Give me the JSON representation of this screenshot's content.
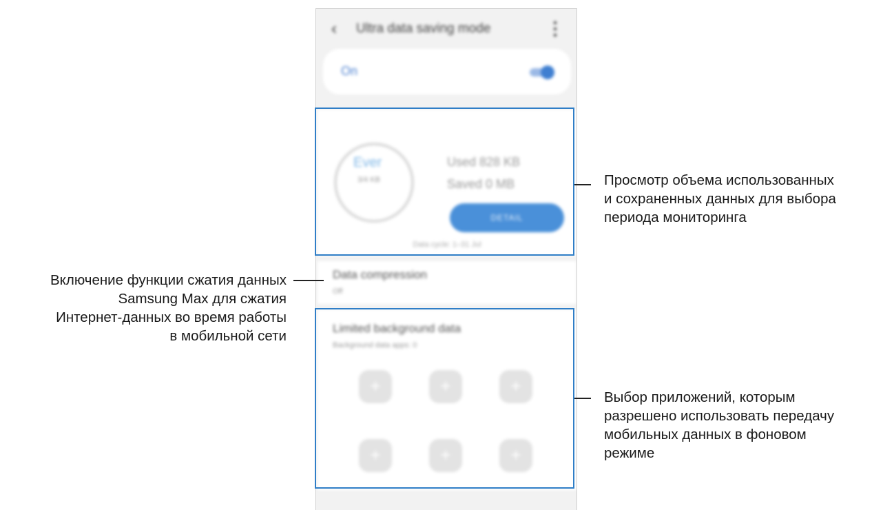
{
  "phone": {
    "appbar": {
      "title": "Ultra data saving mode"
    },
    "toggle": {
      "label": "On",
      "state": "on"
    },
    "usage": {
      "ring_value": "Ever",
      "ring_sub": "3/4 KB",
      "used": "Used 828 KB",
      "saved": "Saved 0 MB",
      "detail_button": "DETAIL",
      "cycle": "Data cycle: 1–31 Jul"
    },
    "compression": {
      "title": "Data compression",
      "subtitle": "Off"
    },
    "background": {
      "title": "Limited background data",
      "subtitle": "Background data apps: 0",
      "tiles": [
        "+",
        "+",
        "+",
        "+",
        "+",
        "+"
      ]
    }
  },
  "callouts": {
    "usage": [
      "Просмотр объема использованных",
      "и сохраненных данных для выбора",
      "периода мониторинга"
    ],
    "compression": [
      "Включение функции сжатия данных",
      "Samsung Max для сжатия",
      "Интернет-данных во время работы",
      "в мобильной сети"
    ],
    "background": [
      "Выбор приложений, которым",
      "разрешено использовать передачу",
      "мобильных данных в фоновом",
      "режиме"
    ]
  },
  "colors": {
    "accent": "#2f7ec7",
    "button": "#4a90d9",
    "toggle": "#3f7fd1"
  }
}
